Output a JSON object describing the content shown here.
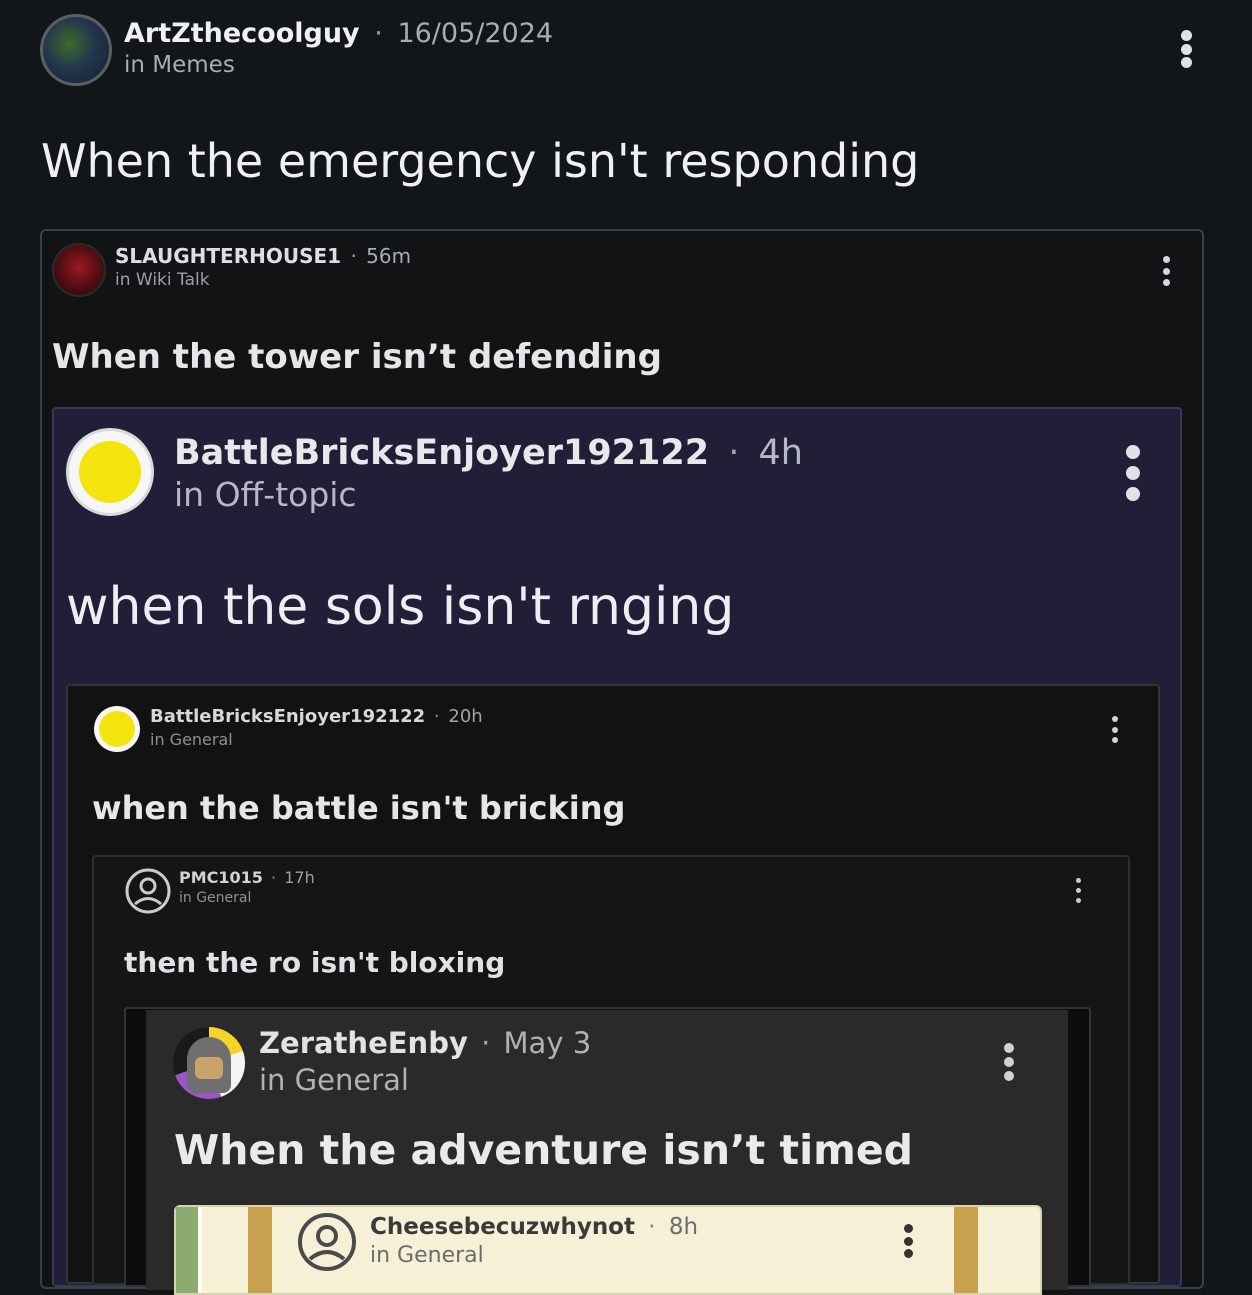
{
  "post": {
    "author": "ArtZthecoolguy",
    "date": "16/05/2024",
    "community": "in Memes",
    "title": "When the emergency isn't responding"
  },
  "embed1": {
    "author": "SLAUGHTERHOUSE1",
    "time": "56m",
    "community": "in Wiki Talk",
    "text": "When the tower isn’t defending"
  },
  "embed2": {
    "author": "BattleBricksEnjoyer192122",
    "time": "4h",
    "community": "in Off-topic",
    "text": "when the sols isn't rnging"
  },
  "embed3": {
    "author": "BattleBricksEnjoyer192122",
    "time": "20h",
    "community": "in General",
    "text": "when the battle isn't bricking"
  },
  "embed4": {
    "author": "PMC1015",
    "time": "17h",
    "community": "in General",
    "text": "then the ro isn't bloxing"
  },
  "embed5": {
    "author": "ZeratheEnby",
    "time": "May 3",
    "community": "in General",
    "text": "When the adventure isn’t timed"
  },
  "embed6": {
    "author": "Cheesebecuzwhynot",
    "time": "8h",
    "community": "in General"
  },
  "separator": "·",
  "colors": {
    "background": "#131619",
    "embed2_bg": "#211f38",
    "embed3_bg": "#121212",
    "embed5_bg": "#2a2a2a",
    "embed6_bg": "#f6f1d6",
    "yellow_avatar": "#f2e40c"
  }
}
